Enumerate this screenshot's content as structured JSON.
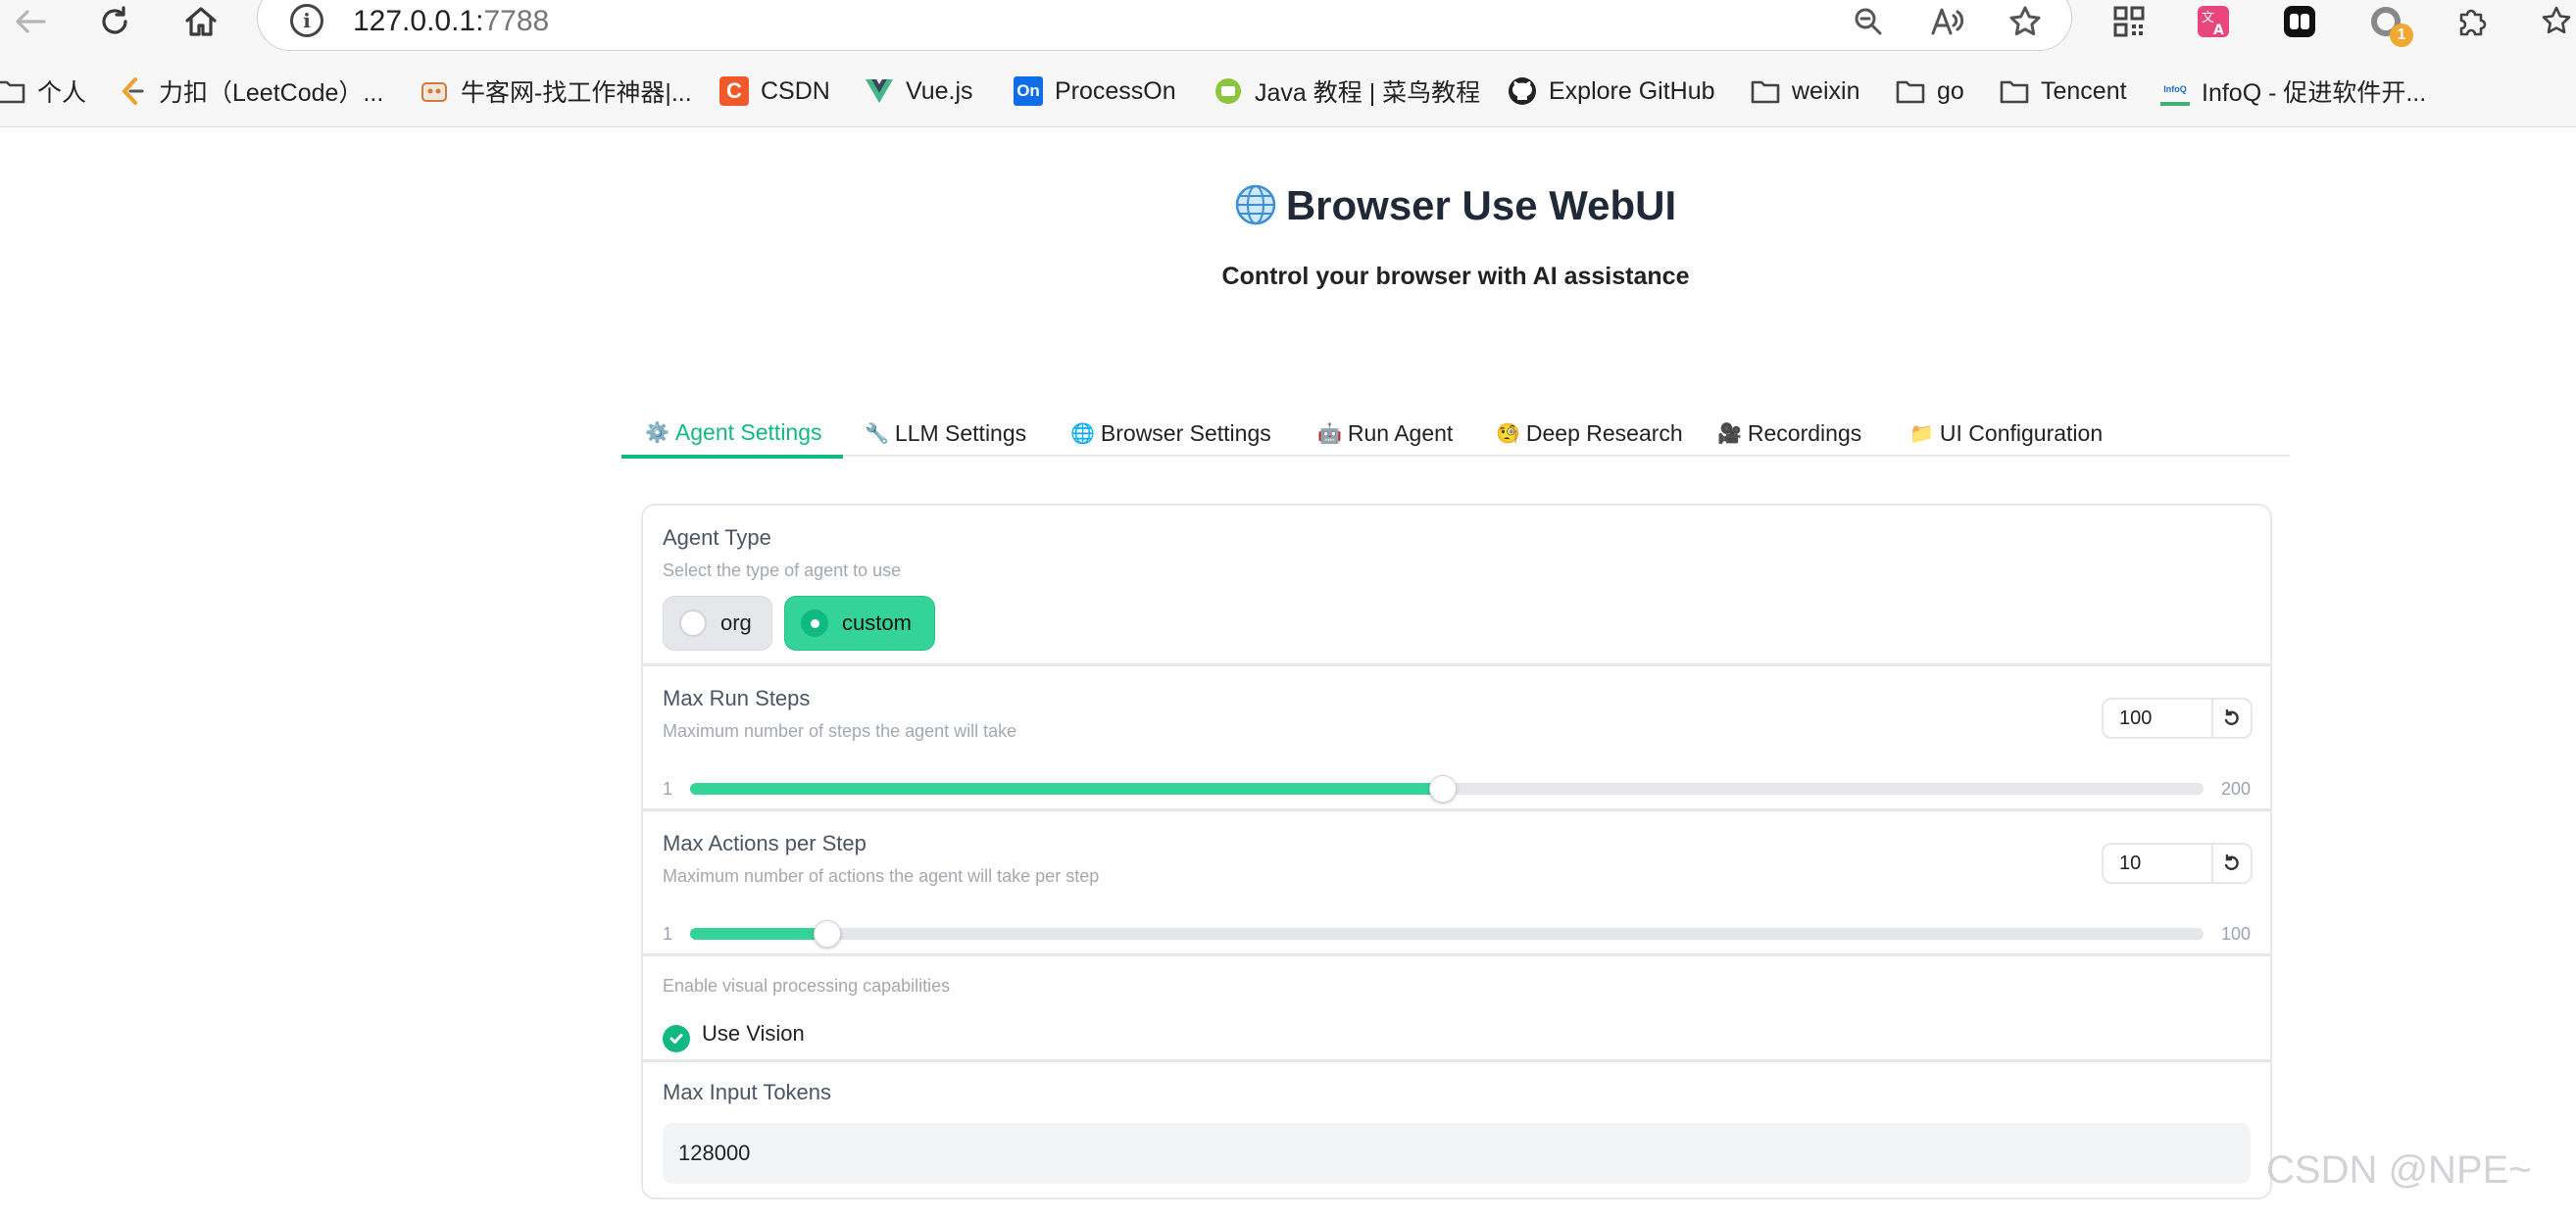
{
  "browser": {
    "url_host": "127.0.0.1:",
    "url_port": "7788",
    "extension_badge": "1",
    "bookmarks": [
      {
        "label": "个人",
        "icon": "folder-icon"
      },
      {
        "label": "力扣（LeetCode）...",
        "icon": "leetcode-icon"
      },
      {
        "label": "牛客网-找工作神器|...",
        "icon": "nowcoder-icon"
      },
      {
        "label": "CSDN",
        "icon": "csdn-icon"
      },
      {
        "label": "Vue.js",
        "icon": "vue-icon"
      },
      {
        "label": "ProcessOn",
        "icon": "processon-icon"
      },
      {
        "label": "Java 教程 | 菜鸟教程",
        "icon": "runoob-icon"
      },
      {
        "label": "Explore GitHub",
        "icon": "github-icon"
      },
      {
        "label": "weixin",
        "icon": "folder-icon"
      },
      {
        "label": "go",
        "icon": "folder-icon"
      },
      {
        "label": "Tencent",
        "icon": "folder-icon"
      },
      {
        "label": "InfoQ - 促进软件开...",
        "icon": "infoq-icon"
      }
    ],
    "bookmark_glyphs": {
      "csdn": "C",
      "processon": "On",
      "infoq": "InfoQ"
    }
  },
  "page": {
    "title": "Browser Use WebUI",
    "subtitle": "Control your browser with AI assistance"
  },
  "tabs": [
    {
      "emoji": "⚙️",
      "label": "Agent Settings",
      "active": true
    },
    {
      "emoji": "🔧",
      "label": "LLM Settings"
    },
    {
      "emoji": "🌐",
      "label": "Browser Settings"
    },
    {
      "emoji": "🤖",
      "label": "Run Agent"
    },
    {
      "emoji": "🧐",
      "label": "Deep Research"
    },
    {
      "emoji": "🎥",
      "label": "Recordings"
    },
    {
      "emoji": "📁",
      "label": "UI Configuration"
    }
  ],
  "agent_type": {
    "label": "Agent Type",
    "info": "Select the type of agent to use",
    "options": [
      "org",
      "custom"
    ],
    "selected": "custom"
  },
  "max_run_steps": {
    "label": "Max Run Steps",
    "info": "Maximum number of steps the agent will take",
    "value": "100",
    "min": "1",
    "max": "200",
    "fraction": 0.4975
  },
  "max_actions": {
    "label": "Max Actions per Step",
    "info": "Maximum number of actions the agent will take per step",
    "value": "10",
    "min": "1",
    "max": "100",
    "fraction": 0.0909
  },
  "vision": {
    "info": "Enable visual processing capabilities",
    "label": "Use Vision",
    "checked": true
  },
  "max_input_tokens": {
    "label": "Max Input Tokens",
    "value": "128000"
  },
  "watermark": "CSDN @NPE~",
  "colors": {
    "accent": "#10b981",
    "accent_light": "#34d399"
  }
}
